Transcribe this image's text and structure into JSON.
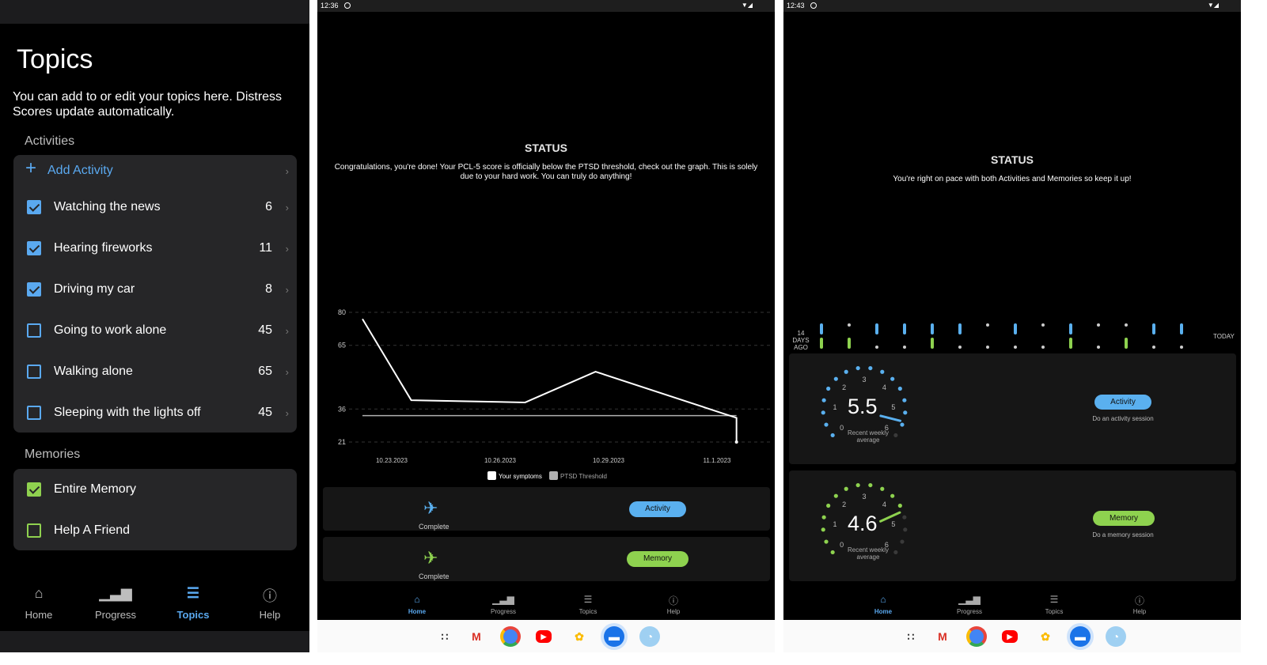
{
  "topics_screen": {
    "title": "Topics",
    "description": "You can add to or edit your topics here. Distress Scores update automatically.",
    "activities_label": "Activities",
    "add_activity": "Add Activity",
    "activities": [
      {
        "label": "Watching the news",
        "score": "6",
        "checked": true
      },
      {
        "label": "Hearing fireworks",
        "score": "11",
        "checked": true
      },
      {
        "label": "Driving my car",
        "score": "8",
        "checked": true
      },
      {
        "label": "Going to work alone",
        "score": "45",
        "checked": false
      },
      {
        "label": "Walking alone",
        "score": "65",
        "checked": false
      },
      {
        "label": "Sleeping with the lights off",
        "score": "45",
        "checked": false
      }
    ],
    "memories_label": "Memories",
    "memories": [
      {
        "label": "Entire Memory",
        "checked": true
      },
      {
        "label": "Help A Friend",
        "checked": false
      }
    ],
    "nav": [
      {
        "label": "Home",
        "icon": "home-icon"
      },
      {
        "label": "Progress",
        "icon": "bar-chart-icon"
      },
      {
        "label": "Topics",
        "icon": "list-icon",
        "active": true
      },
      {
        "label": "Help",
        "icon": "info-icon"
      }
    ]
  },
  "status_screen_1": {
    "time": "12:36",
    "title": "STATUS",
    "message": "Congratulations, you're done! Your PCL-5 score is officially below the PTSD threshold, check out the graph. This is solely due to your hard work. You can truly do anything!",
    "activity_complete": "Complete",
    "memory_complete": "Complete",
    "activity_button": "Activity",
    "memory_button": "Memory",
    "nav": [
      {
        "label": "Home",
        "active": true
      },
      {
        "label": "Progress"
      },
      {
        "label": "Topics"
      },
      {
        "label": "Help"
      }
    ]
  },
  "chart_data": {
    "type": "line",
    "x": [
      "10.23.2023",
      "10.26.2023",
      "10.29.2023",
      "11.1.2023"
    ],
    "y_ticks": [
      "80",
      "65",
      "36",
      "21"
    ],
    "series": [
      {
        "name": "Your symptoms",
        "points": [
          [
            0,
            77
          ],
          [
            0.45,
            40
          ],
          [
            1.5,
            39
          ],
          [
            2.15,
            53
          ],
          [
            3.45,
            32
          ],
          [
            3.45,
            21
          ]
        ]
      },
      {
        "name": "PTSD Threshold",
        "points": [
          [
            0,
            33
          ],
          [
            3.45,
            33
          ]
        ]
      }
    ],
    "legend": [
      "Your symptoms",
      "PTSD Threshold"
    ],
    "colors": {
      "symptoms": "#ffffff",
      "threshold": "#b0b0b0"
    }
  },
  "status_screen_2": {
    "time": "12:43",
    "title": "STATUS",
    "message": "You're right on pace with both Activities and Memories so keep it up!",
    "timeline_start": "14 DAYS AGO",
    "timeline_end": "TODAY",
    "activity_average": "5.5",
    "memory_average": "4.6",
    "average_caption": "Recent weekly average",
    "activity_button": "Activity",
    "activity_sub": "Do an activity session",
    "memory_button": "Memory",
    "memory_sub": "Do a memory session",
    "gauge_ticks": [
      "0",
      "1",
      "2",
      "3",
      "4",
      "5",
      "6"
    ],
    "activity_fraction": 0.917,
    "memory_fraction": 0.767,
    "nav": [
      {
        "label": "Home",
        "active": true
      },
      {
        "label": "Progress"
      },
      {
        "label": "Topics"
      },
      {
        "label": "Help"
      }
    ]
  },
  "dock_apps": [
    "apps-grid-icon",
    "gmail-icon",
    "chrome-icon",
    "youtube-icon",
    "photos-icon",
    "messages-icon",
    "speedometer-icon"
  ],
  "accent_blue": "#5aa9f0",
  "accent_green": "#8fd14f"
}
